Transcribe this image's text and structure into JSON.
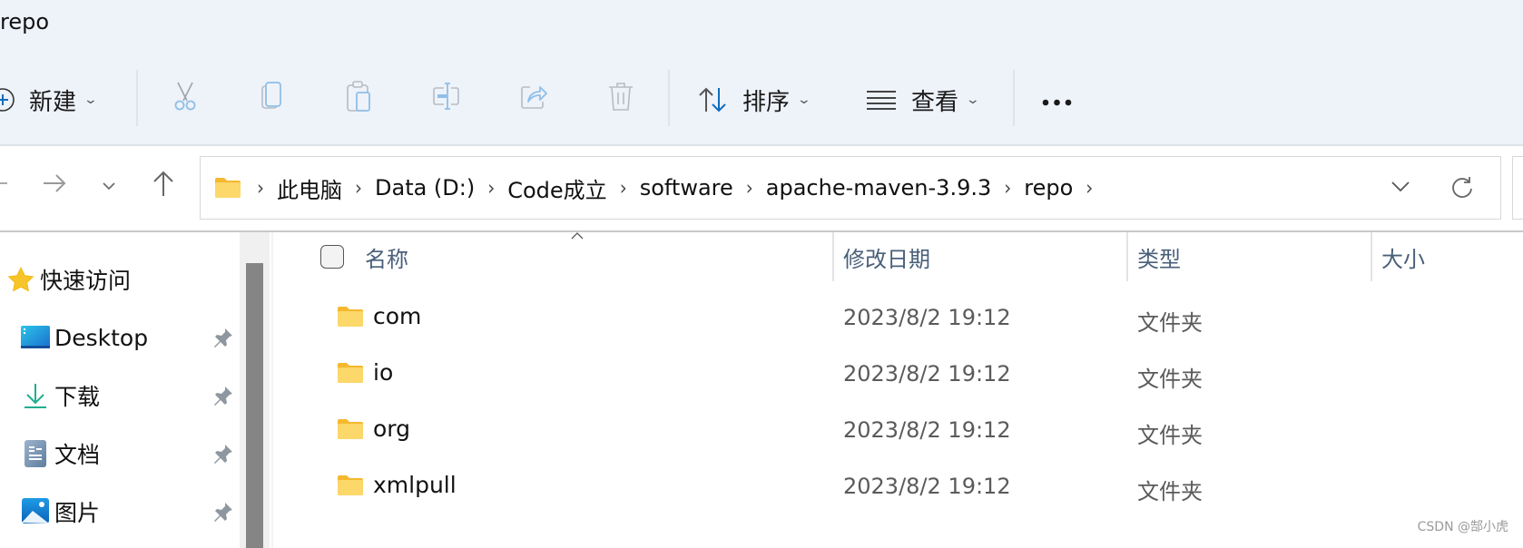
{
  "window": {
    "title": "repo"
  },
  "toolbar": {
    "new_label": "新建",
    "sort_label": "排序",
    "view_label": "查看",
    "more_label": "•••",
    "icons": [
      "cut-icon",
      "copy-icon",
      "paste-icon",
      "rename-icon",
      "share-icon",
      "delete-icon"
    ]
  },
  "address_bar": {
    "crumbs": [
      "此电脑",
      "Data (D:)",
      "Code成立",
      "software",
      "apache-maven-3.9.3",
      "repo"
    ]
  },
  "sidebar": {
    "quick_access": "快速访问",
    "items": [
      {
        "label": "Desktop",
        "icon": "desktop-icon",
        "pinned": true
      },
      {
        "label": "下载",
        "icon": "download-icon",
        "pinned": true
      },
      {
        "label": "文档",
        "icon": "documents-icon",
        "pinned": true
      },
      {
        "label": "图片",
        "icon": "pictures-icon",
        "pinned": true
      }
    ]
  },
  "file_list": {
    "columns": [
      "名称",
      "修改日期",
      "类型",
      "大小"
    ],
    "sort_column": "名称",
    "sort_direction": "ascending",
    "rows": [
      {
        "name": "com",
        "modified": "2023/8/2 19:12",
        "type": "文件夹",
        "size": ""
      },
      {
        "name": "io",
        "modified": "2023/8/2 19:12",
        "type": "文件夹",
        "size": ""
      },
      {
        "name": "org",
        "modified": "2023/8/2 19:12",
        "type": "文件夹",
        "size": ""
      },
      {
        "name": "xmlpull",
        "modified": "2023/8/2 19:12",
        "type": "文件夹",
        "size": ""
      }
    ]
  },
  "colors": {
    "toolbar_bg": "#eef2f9",
    "accent_blue": "#0f6cbd",
    "folder_yellow": "#f8c94a",
    "header_text": "#4a5f7a"
  },
  "watermark": "CSDN @郜小虎"
}
